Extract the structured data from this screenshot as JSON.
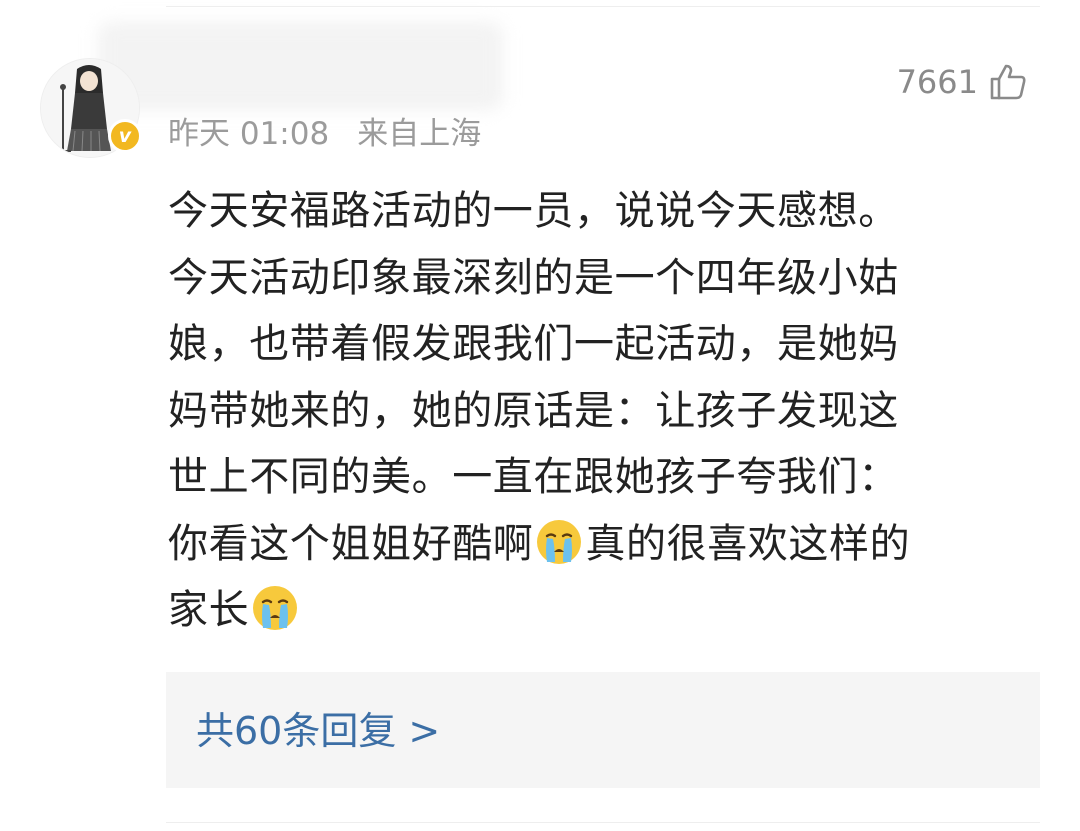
{
  "comment": {
    "timestamp": "昨天 01:08",
    "location": "来自上海",
    "like_count": "7661",
    "like_icon": "thumbs-up-outline-icon",
    "verified_badge_letter": "v",
    "verified_badge_color": "#f2b820",
    "body_lines": [
      "今天安福路活动的一员，说说今天感想。",
      "今天活动印象最深刻的是一个四年级小姑",
      "娘，也带着假发跟我们一起活动，是她妈",
      "妈带她来的，她的原话是：让孩子发现这",
      "世上不同的美。一直在跟她孩子夸我们："
    ],
    "line6_before_emoji": "你看这个姐姐好酷啊",
    "line6_after_emoji": "真的很喜欢这样的",
    "line7_text": "家长",
    "emoji_name": "crying-face-emoji",
    "replies_label": "共60条回复 >",
    "link_color": "#3b6ea5"
  }
}
